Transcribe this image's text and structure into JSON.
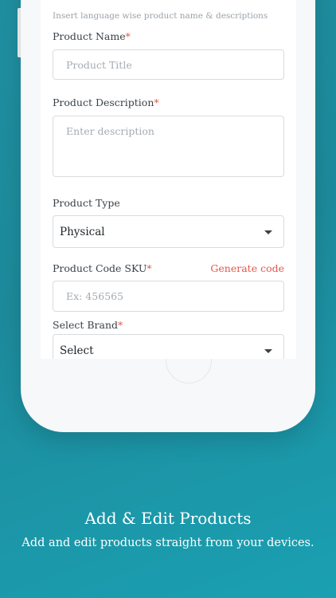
{
  "form": {
    "hint": "Insert language wise product name & descriptions",
    "product_name": {
      "label": "Product Name",
      "required_mark": "*",
      "placeholder": "Product Title"
    },
    "product_description": {
      "label": "Product Description",
      "required_mark": "*",
      "placeholder": "Enter description"
    },
    "product_type": {
      "label": "Product Type",
      "selected": "Physical"
    },
    "product_code": {
      "label": "Product Code SKU",
      "required_mark": "*",
      "generate_link": "Generate code",
      "placeholder": "Ex: 456565"
    },
    "brand": {
      "label": "Select Brand",
      "required_mark": "*",
      "selected": "Select"
    }
  },
  "caption": {
    "title": "Add & Edit Products",
    "subtitle": "Add and edit products straight from your devices."
  },
  "colors": {
    "background_teal": "#1d8b9c",
    "required_red": "#e4574c",
    "link_red": "#e4574c"
  },
  "icons": {
    "dropdown": "chevron-down-icon"
  }
}
